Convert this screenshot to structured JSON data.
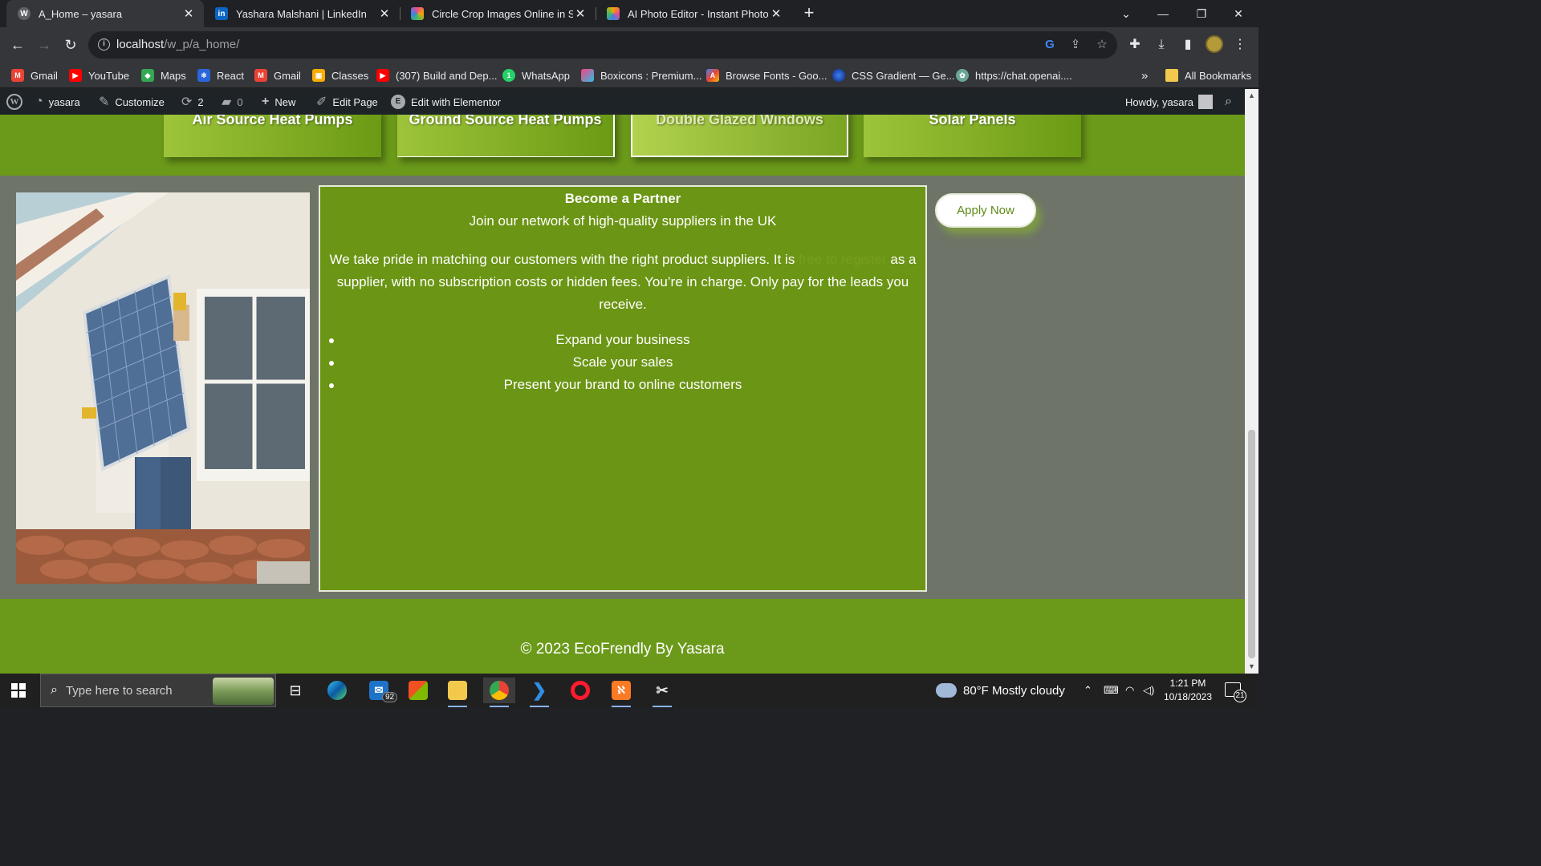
{
  "browser": {
    "tabs": [
      {
        "title": "A_Home – yasara",
        "favicon": "wordpress-icon",
        "color": "#5f6368",
        "active": true
      },
      {
        "title": "Yashara Malshani | LinkedIn",
        "favicon": "linkedin-icon",
        "color": "#0a66c2",
        "active": false
      },
      {
        "title": "Circle Crop Images Online in Sec",
        "favicon": "color-square-icon",
        "color": "#e94f8a",
        "active": false
      },
      {
        "title": "AI Photo Editor - Instant Photo E",
        "favicon": "color-square-icon",
        "color": "#f4a300",
        "active": false
      }
    ],
    "url_host": "localhost",
    "url_path": "/w_p/a_home/",
    "bookmarks": [
      {
        "label": "Gmail",
        "icon": "gmail-icon"
      },
      {
        "label": "YouTube",
        "icon": "youtube-icon"
      },
      {
        "label": "Maps",
        "icon": "maps-icon"
      },
      {
        "label": "React",
        "icon": "react-icon"
      },
      {
        "label": "Gmail",
        "icon": "gmail-icon"
      },
      {
        "label": "Classes",
        "icon": "classroom-icon"
      },
      {
        "label": "(307) Build and Dep...",
        "icon": "youtube-icon"
      },
      {
        "label": "WhatsApp",
        "icon": "whatsapp-icon"
      },
      {
        "label": "Boxicons : Premium...",
        "icon": "boxicons-icon"
      },
      {
        "label": "Browse Fonts - Goo...",
        "icon": "google-fonts-icon"
      },
      {
        "label": "CSS Gradient — Ge...",
        "icon": "css-gradient-icon"
      },
      {
        "label": "https://chat.openai....",
        "icon": "openai-icon"
      }
    ],
    "bookmarks_overflow": "»",
    "all_bookmarks": "All Bookmarks"
  },
  "wp_admin_bar": {
    "site_name": "yasara",
    "customize": "Customize",
    "updates_count": "2",
    "comments_count": "0",
    "new_label": "New",
    "edit_page": "Edit Page",
    "edit_elementor": "Edit with Elementor",
    "howdy": "Howdy, yasara"
  },
  "services": [
    {
      "label": "Air Source Heat Pumps"
    },
    {
      "label": "Ground Source Heat Pumps"
    },
    {
      "label": "Double Glazed Windows"
    },
    {
      "label": "Solar Panels"
    }
  ],
  "partner": {
    "heading": "Become a Partner",
    "subheading": "Join our network of high-quality suppliers in the UK",
    "body_before": "We take pride in matching our customers with the right product suppliers. It is ",
    "body_hidden": "free to register",
    "body_after": " as a supplier, with no subscription costs or hidden fees. You’re in charge. Only pay for the leads you receive.",
    "bullets": [
      "Expand your business",
      "Scale your sales",
      "Present your brand to online customers"
    ]
  },
  "apply_button": "Apply Now",
  "footer_text": "© 2023 EcoFrendly By Yasara",
  "taskbar": {
    "search_placeholder": "Type here to search",
    "mail_badge": "92",
    "weather": "80°F  Mostly cloudy",
    "time": "1:21 PM",
    "date": "10/18/2023",
    "notifications": "21"
  },
  "colors": {
    "brand_green": "#6b9a1a",
    "partner_green": "#6b9514",
    "page_gray": "#6e7468",
    "wp_bar": "#1d2327"
  }
}
